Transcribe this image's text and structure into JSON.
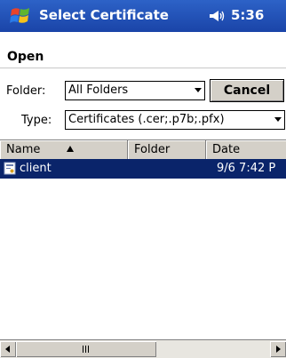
{
  "titlebar": {
    "title": "Select Certificate",
    "time": "5:36",
    "start_icon": "windows-flag-icon",
    "volume_icon": "speaker-icon",
    "color": "#2457bd"
  },
  "command_bar": {
    "open_label": "Open"
  },
  "folder": {
    "label": "Folder:",
    "selected": "All Folders"
  },
  "cancel_button": {
    "label": "Cancel"
  },
  "type": {
    "label": "Type:",
    "selected": "Certificates (.cer;.p7b;.pfx)"
  },
  "list": {
    "columns": [
      {
        "label": "Name",
        "sorted": "ascending"
      },
      {
        "label": "Folder"
      },
      {
        "label": "Date"
      }
    ],
    "rows": [
      {
        "name": "client",
        "date": "9/6 7:42 P",
        "selected": true
      }
    ],
    "selection_color": "#0a246a"
  },
  "scrollbar": {
    "orientation": "horizontal"
  }
}
